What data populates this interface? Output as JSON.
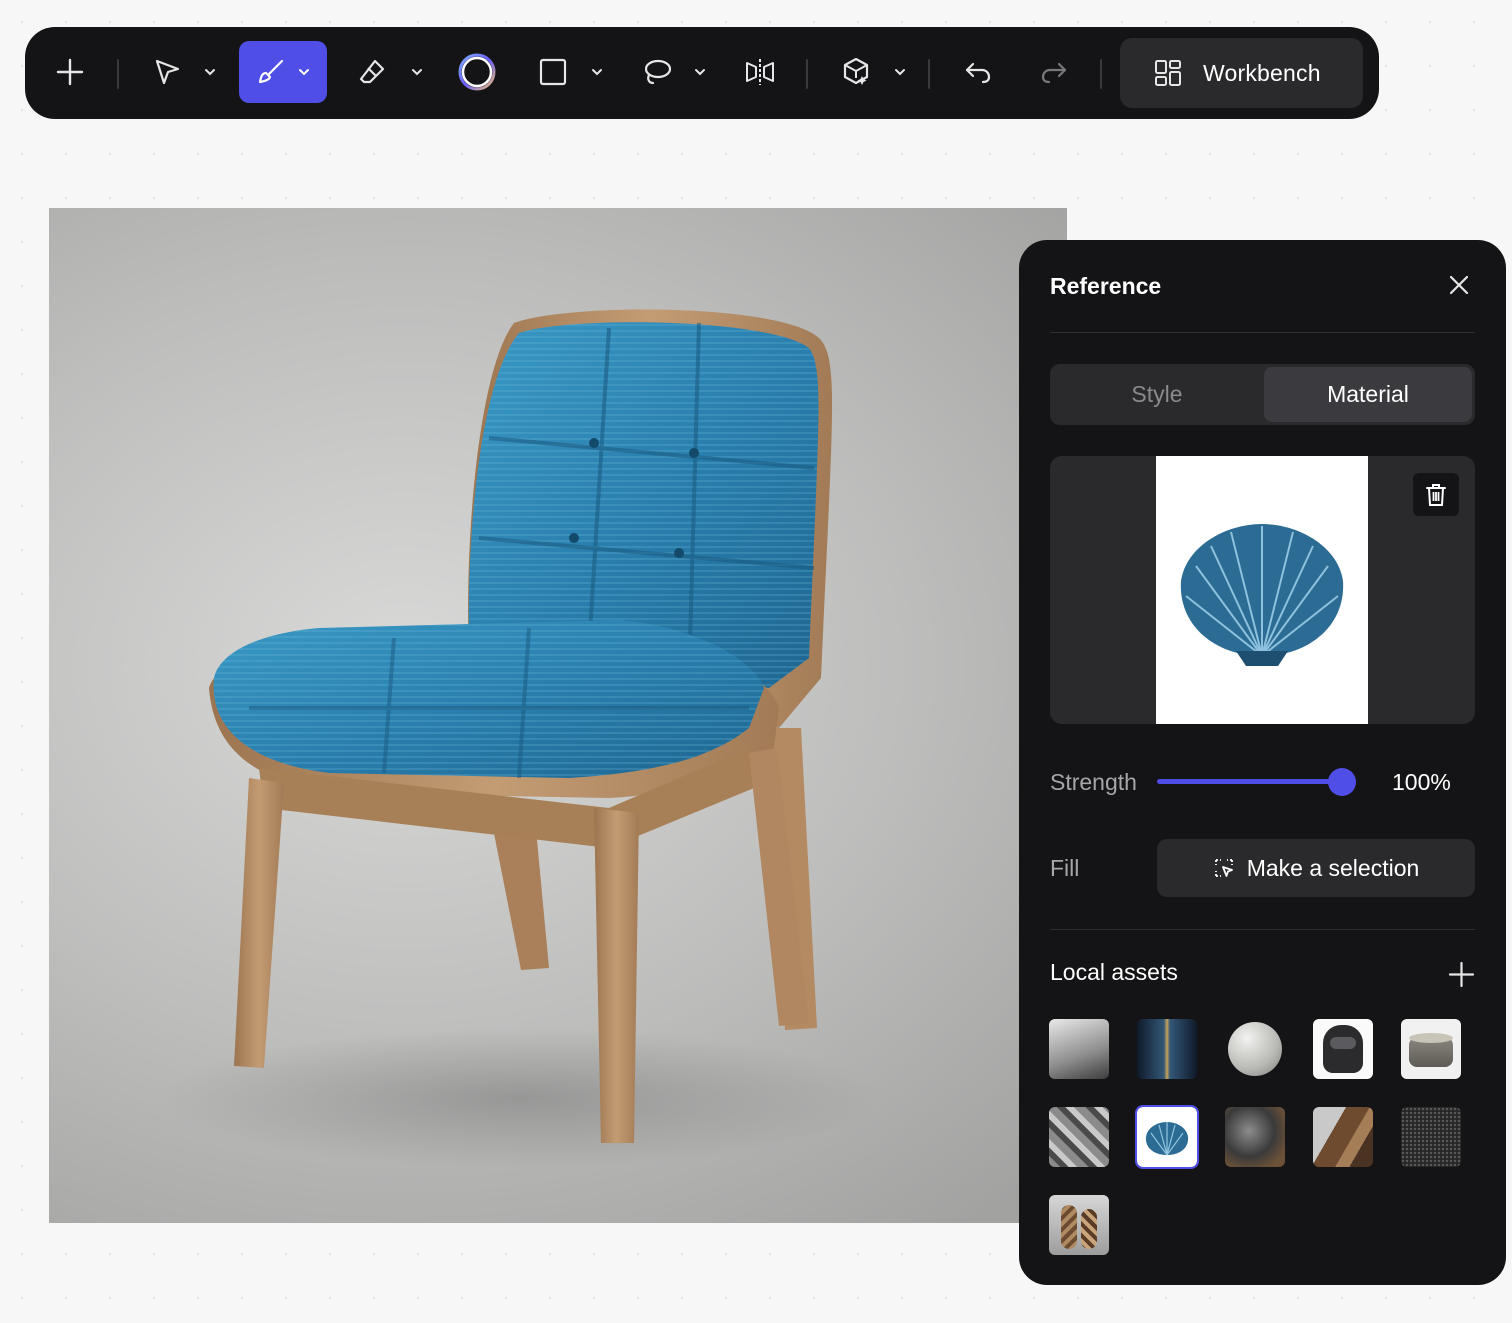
{
  "toolbar": {
    "workbench_label": "Workbench",
    "tools": [
      {
        "name": "add",
        "icon": "plus-icon"
      },
      {
        "name": "select",
        "icon": "cursor-arrow-icon",
        "has_dropdown": true
      },
      {
        "name": "brush",
        "icon": "brush-icon",
        "has_dropdown": true,
        "active": true
      },
      {
        "name": "eraser",
        "icon": "eraser-icon",
        "has_dropdown": true
      },
      {
        "name": "color",
        "icon": "color-ring-icon"
      },
      {
        "name": "rectangle",
        "icon": "square-icon",
        "has_dropdown": true
      },
      {
        "name": "lasso",
        "icon": "lasso-icon",
        "has_dropdown": true
      },
      {
        "name": "mirror",
        "icon": "flip-icon"
      },
      {
        "name": "3d",
        "icon": "cube-sparkle-icon",
        "has_dropdown": true
      },
      {
        "name": "undo",
        "icon": "undo-icon"
      },
      {
        "name": "redo",
        "icon": "redo-icon"
      }
    ]
  },
  "panel": {
    "title": "Reference",
    "tabs": [
      {
        "label": "Style",
        "active": false
      },
      {
        "label": "Material",
        "active": true
      }
    ],
    "strength_label": "Strength",
    "strength_value": "100%",
    "strength_fraction": 1.0,
    "fill_label": "Fill",
    "fill_button_label": "Make a selection",
    "assets_title": "Local assets",
    "assets": [
      {
        "icon": "interior-thumb"
      },
      {
        "icon": "cathedral-thumb"
      },
      {
        "icon": "sphere-thumb"
      },
      {
        "icon": "helmet-thumb"
      },
      {
        "icon": "stone-bowl-thumb"
      },
      {
        "icon": "collage-thumb"
      },
      {
        "icon": "seashell-thumb",
        "selected": true
      },
      {
        "icon": "rock-thumb"
      },
      {
        "icon": "wood-swirl-thumb"
      },
      {
        "icon": "granite-thumb"
      },
      {
        "icon": "vases-thumb"
      }
    ]
  },
  "colors": {
    "accent": "#4f4ee6",
    "panel_bg": "#141416",
    "chair_fabric": "#2f87b4",
    "chair_wood": "#b58c64"
  }
}
